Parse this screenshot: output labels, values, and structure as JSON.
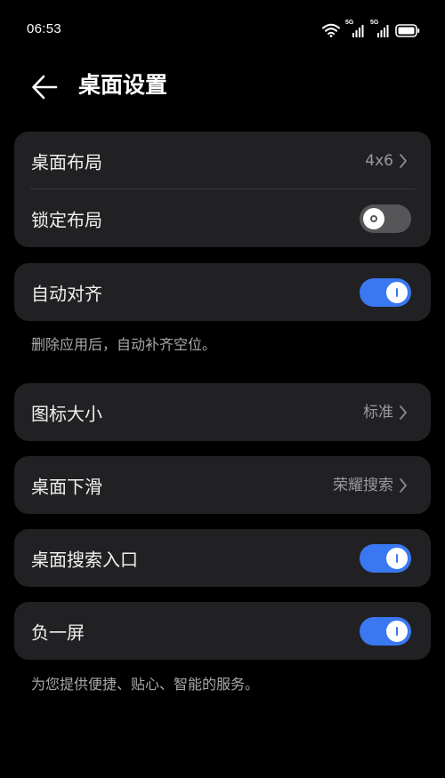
{
  "status_bar": {
    "time": "06:53",
    "network_tag_1": "5G",
    "network_tag_2": "5G",
    "icons": [
      "wifi-icon",
      "signal-icon",
      "signal-icon",
      "battery-icon"
    ]
  },
  "header": {
    "back_icon": "arrow-left-icon",
    "title": "桌面设置"
  },
  "settings": {
    "layout": {
      "label": "桌面布局",
      "value": "4x6"
    },
    "lock_layout": {
      "label": "锁定布局",
      "enabled": false
    },
    "auto_align": {
      "label": "自动对齐",
      "enabled": true,
      "hint": "删除应用后，自动补齐空位。"
    },
    "icon_size": {
      "label": "图标大小",
      "value": "标准"
    },
    "swipe_down": {
      "label": "桌面下滑",
      "value": "荣耀搜索"
    },
    "search_entry": {
      "label": "桌面搜索入口",
      "enabled": true
    },
    "minus_one_screen": {
      "label": "负一屏",
      "enabled": true,
      "hint": "为您提供便捷、贴心、智能的服务。"
    }
  },
  "colors": {
    "background": "#000000",
    "card": "#212124",
    "accent": "#3a78f2",
    "toggle_off": "#565658",
    "secondary_text": "#9a9a9c"
  }
}
